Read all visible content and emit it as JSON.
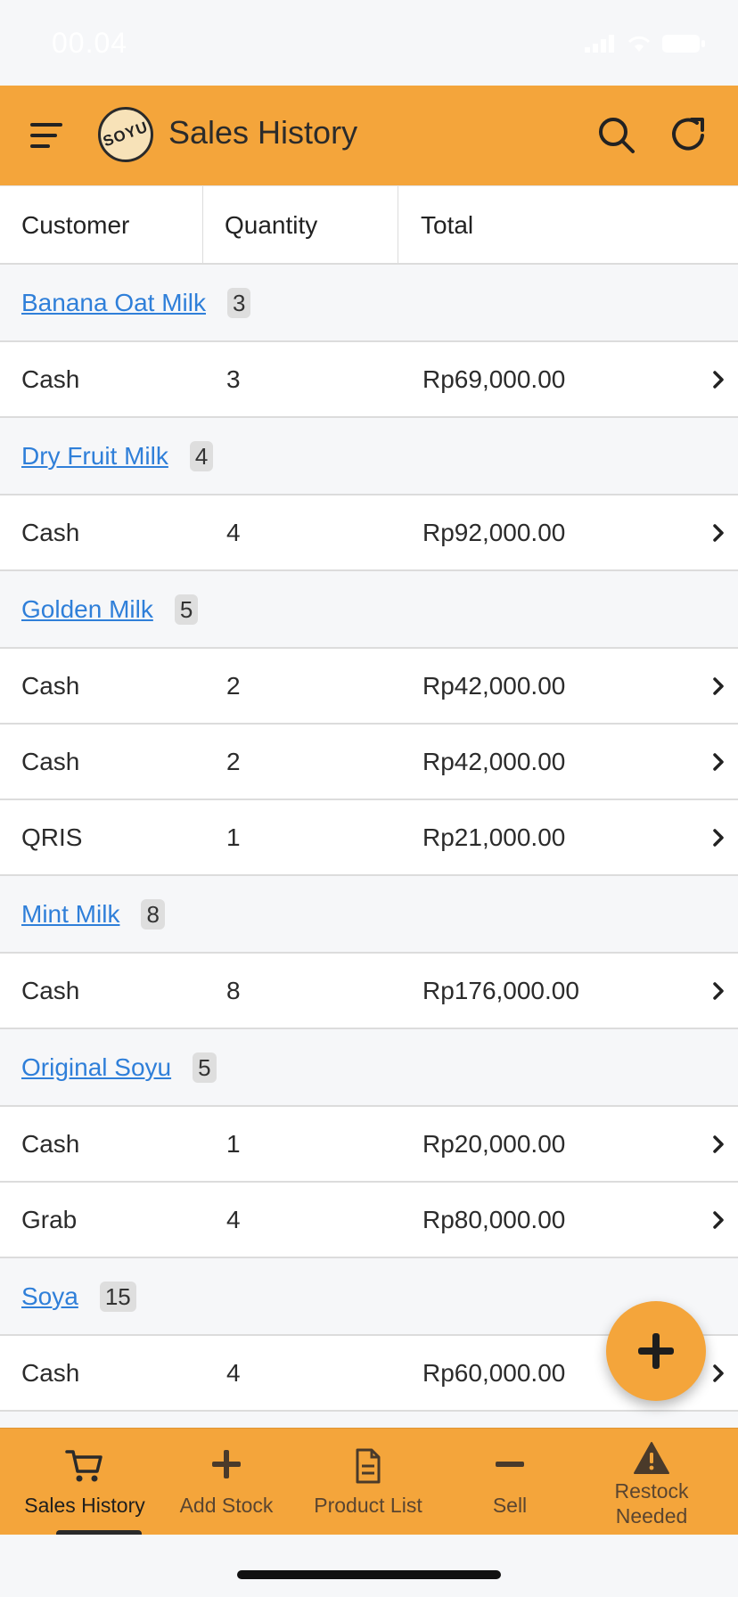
{
  "status_bar": {
    "time": "00.04"
  },
  "app_bar": {
    "title": "Sales History",
    "logo_text": "SOYU",
    "icons": {
      "menu": "menu-icon",
      "search": "search-icon",
      "refresh": "refresh-icon"
    }
  },
  "table": {
    "columns": [
      "Customer",
      "Quantity",
      "Total"
    ]
  },
  "groups": [
    {
      "name": "Banana Oat Milk",
      "count": "3",
      "rows": [
        {
          "customer": "Cash",
          "quantity": "3",
          "total": "Rp69,000.00"
        }
      ]
    },
    {
      "name": "Dry Fruit Milk",
      "count": "4",
      "rows": [
        {
          "customer": "Cash",
          "quantity": "4",
          "total": "Rp92,000.00"
        }
      ]
    },
    {
      "name": "Golden Milk",
      "count": "5",
      "rows": [
        {
          "customer": "Cash",
          "quantity": "2",
          "total": "Rp42,000.00"
        },
        {
          "customer": "Cash",
          "quantity": "2",
          "total": "Rp42,000.00"
        },
        {
          "customer": "QRIS",
          "quantity": "1",
          "total": "Rp21,000.00"
        }
      ]
    },
    {
      "name": "Mint Milk",
      "count": "8",
      "rows": [
        {
          "customer": "Cash",
          "quantity": "8",
          "total": "Rp176,000.00"
        }
      ]
    },
    {
      "name": "Original Soyu",
      "count": "5",
      "rows": [
        {
          "customer": "Cash",
          "quantity": "1",
          "total": "Rp20,000.00"
        },
        {
          "customer": "Grab",
          "quantity": "4",
          "total": "Rp80,000.00"
        }
      ]
    },
    {
      "name": "Soya",
      "count": "15",
      "rows": [
        {
          "customer": "Cash",
          "quantity": "4",
          "total": "Rp60,000.00"
        }
      ]
    }
  ],
  "fab": {
    "icon": "plus-icon"
  },
  "bottom_nav": {
    "active": "Sales History",
    "items": [
      {
        "label": "Sales History",
        "icon": "cart-icon"
      },
      {
        "label": "Add Stock",
        "icon": "plus-icon"
      },
      {
        "label": "Product List",
        "icon": "document-icon"
      },
      {
        "label": "Sell",
        "icon": "minus-icon"
      },
      {
        "label": "Restock Needed",
        "icon": "warning-icon"
      }
    ]
  },
  "colors": {
    "accent": "#f4a53b",
    "link": "#2f7fd9",
    "background": "#f6f7f9"
  }
}
